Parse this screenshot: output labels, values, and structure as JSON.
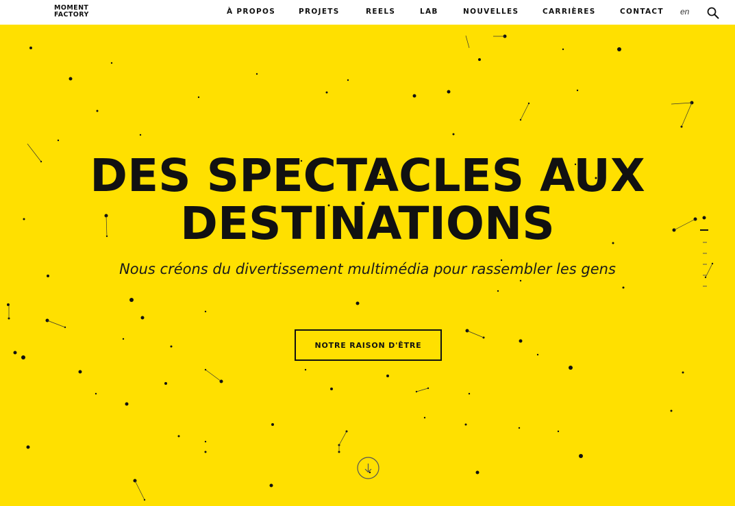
{
  "logo": {
    "line1": "MOMENT",
    "line2": "FACTORY"
  },
  "nav": {
    "items": [
      {
        "label": "À PROPOS"
      },
      {
        "label": "PROJETS"
      },
      {
        "label": "REELS"
      },
      {
        "label": "LAB"
      },
      {
        "label": "NOUVELLES"
      },
      {
        "label": "CARRIÈRES"
      },
      {
        "label": "CONTACT"
      }
    ],
    "language": "en"
  },
  "hero": {
    "headline_line1": "DES SPECTACLES AUX",
    "headline_line2": "DESTINATIONS",
    "subtitle": "Nous créons du divertissement multimédia pour rassembler les gens",
    "cta_label": "NOTRE RAISON D'ÊTRE"
  },
  "colors": {
    "background": "#ffe000",
    "header": "#ffffff",
    "text": "#111111"
  },
  "icons": {
    "search": "search-icon",
    "scroll": "arrow-down-circle-icon"
  }
}
